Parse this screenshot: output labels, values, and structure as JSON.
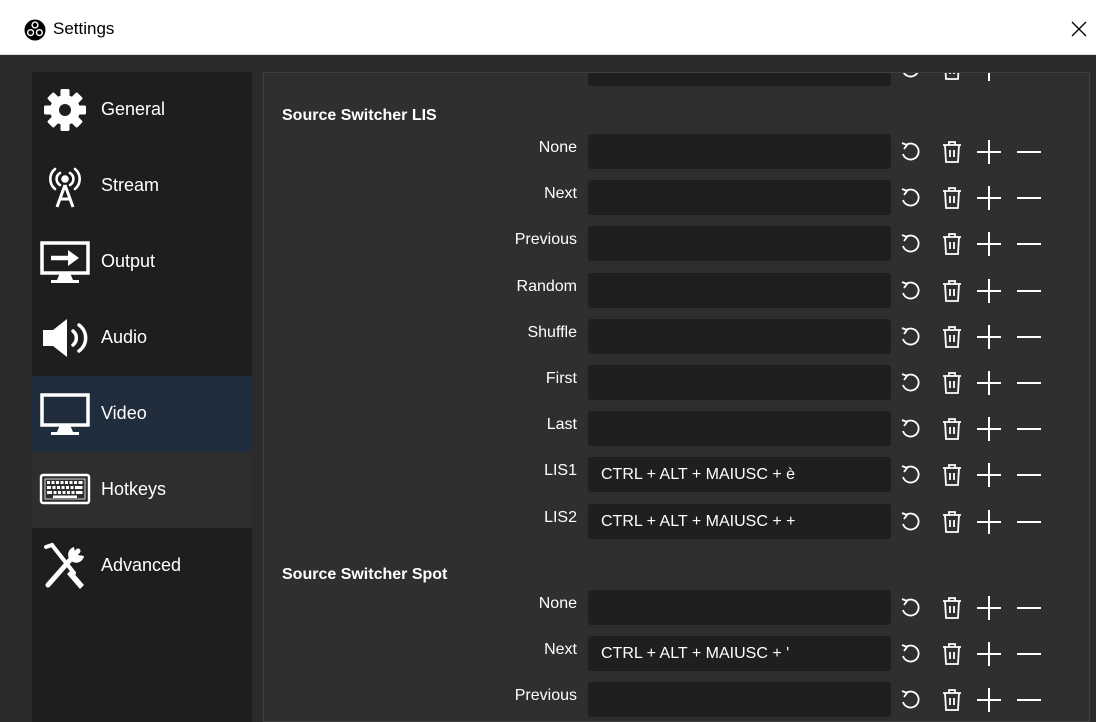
{
  "window": {
    "title": "Settings",
    "close_glyph": "✕",
    "app_icon": "obs-logo-icon"
  },
  "sidebar": {
    "items": [
      {
        "label": "General",
        "icon": "gear-icon",
        "state": "normal"
      },
      {
        "label": "Stream",
        "icon": "broadcast-tower-icon",
        "state": "normal"
      },
      {
        "label": "Output",
        "icon": "output-monitor-icon",
        "state": "normal"
      },
      {
        "label": "Audio",
        "icon": "speaker-icon",
        "state": "normal"
      },
      {
        "label": "Video",
        "icon": "monitor-icon",
        "state": "selected"
      },
      {
        "label": "Hotkeys",
        "icon": "keyboard-icon",
        "state": "hover"
      },
      {
        "label": "Advanced",
        "icon": "tools-icon",
        "state": "normal"
      }
    ]
  },
  "hotkeys": {
    "groups": [
      {
        "title": "Source Switcher LIS",
        "rows": [
          {
            "label": "None",
            "value": ""
          },
          {
            "label": "Next",
            "value": ""
          },
          {
            "label": "Previous",
            "value": ""
          },
          {
            "label": "Random",
            "value": ""
          },
          {
            "label": "Shuffle",
            "value": ""
          },
          {
            "label": "First",
            "value": ""
          },
          {
            "label": "Last",
            "value": ""
          },
          {
            "label": "LIS1",
            "value": "CTRL + ALT + MAIUSC + è"
          },
          {
            "label": "LIS2",
            "value": "CTRL + ALT + MAIUSC + +"
          }
        ]
      },
      {
        "title": "Source Switcher Spot",
        "rows": [
          {
            "label": "None",
            "value": ""
          },
          {
            "label": "Next",
            "value": "CTRL + ALT + MAIUSC + '"
          },
          {
            "label": "Previous",
            "value": ""
          }
        ]
      }
    ],
    "row_buttons": [
      "revert-icon",
      "trash-icon",
      "plus-icon",
      "minus-icon"
    ]
  },
  "colors": {
    "window_bg": "#2b2b2b",
    "sidebar_bg": "#1e1e1e",
    "selected_bg": "#1f2d3d",
    "input_bg": "#1f1f1f",
    "text": "#ffffff"
  }
}
